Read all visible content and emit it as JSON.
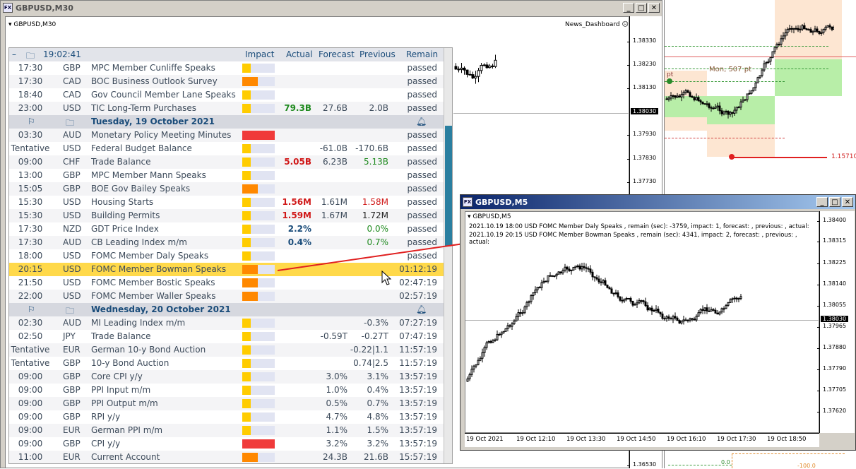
{
  "main_window": {
    "title": "GBPUSD,M30",
    "symbol_label": "GBPUSD,M30",
    "indicator": "News_Dashboard",
    "price_ticks": [
      "1.38330",
      "1.38230",
      "1.38130",
      "1.38030",
      "1.37930",
      "1.37830",
      "1.37730",
      "1.36530"
    ],
    "current_price": "1.38030"
  },
  "right_chart": {
    "level_price": "1.15710",
    "annotation": "Mon, 507 pt",
    "pt_label": "pt",
    "bottom_left": "0.0",
    "bottom_right": "-100.0"
  },
  "m5_window": {
    "title": "GBPUSD,M5",
    "symbol_label": "GBPUSD,M5",
    "log_lines": [
      "2021.10.19 18:00 USD FOMC Member Daly Speaks , remain (sec): -3759, impact: 1, forecast: , previous: , actual:",
      "2021.10.19 20:15 USD FOMC Member Bowman Speaks , remain (sec): 4341, impact: 2, forecast: , previous: , actual:"
    ],
    "price_ticks": [
      "1.38400",
      "1.38315",
      "1.38225",
      "1.38140",
      "1.38055",
      "1.37965",
      "1.37880",
      "1.37790",
      "1.37705",
      "1.37620"
    ],
    "current_price": "1.38030",
    "time_ticks": [
      "19 Oct 2021",
      "19 Oct 12:10",
      "19 Oct 13:30",
      "19 Oct 14:50",
      "19 Oct 16:10",
      "19 Oct 17:30",
      "19 Oct 18:50"
    ]
  },
  "dashboard": {
    "header": {
      "collapse": "–",
      "time": "19:02:41",
      "impact": "Impact",
      "actual": "Actual",
      "forecast": "Forecast",
      "previous": "Previous",
      "remain": "Remain"
    },
    "rows": [
      {
        "type": "event",
        "time": "17:30",
        "cur": "GBP",
        "event": "MPC Member Cunliffe Speaks",
        "impact": 1,
        "actual": "",
        "forecast": "",
        "previous": "",
        "remain": "passed"
      },
      {
        "type": "event",
        "time": "17:30",
        "cur": "CAD",
        "event": "BOC Business Outlook Survey",
        "impact": 2,
        "actual": "",
        "forecast": "",
        "previous": "",
        "remain": "passed"
      },
      {
        "type": "event",
        "time": "18:40",
        "cur": "CAD",
        "event": "Gov Council Member Lane Speaks",
        "impact": 1,
        "actual": "",
        "forecast": "",
        "previous": "",
        "remain": "passed"
      },
      {
        "type": "event",
        "time": "23:00",
        "cur": "USD",
        "event": "TIC Long-Term Purchases",
        "impact": 1,
        "actual": "79.3B",
        "actual_color": "green",
        "forecast": "27.6B",
        "previous": "2.0B",
        "remain": "passed"
      },
      {
        "type": "date",
        "label": "Tuesday, 19 October 2021"
      },
      {
        "type": "event",
        "time": "03:30",
        "cur": "AUD",
        "event": "Monetary Policy Meeting Minutes",
        "impact": 3,
        "actual": "",
        "forecast": "",
        "previous": "",
        "remain": "passed"
      },
      {
        "type": "event",
        "time": "Tentative",
        "cur": "USD",
        "event": "Federal Budget Balance",
        "impact": 1,
        "actual": "",
        "forecast": "-61.0B",
        "previous": "-170.6B",
        "remain": "passed"
      },
      {
        "type": "event",
        "time": "09:00",
        "cur": "CHF",
        "event": "Trade Balance",
        "impact": 1,
        "actual": "5.05B",
        "actual_color": "red",
        "forecast": "6.23B",
        "previous": "5.13B",
        "prev_color": "green",
        "remain": "passed"
      },
      {
        "type": "event",
        "time": "13:00",
        "cur": "GBP",
        "event": "MPC Member Mann Speaks",
        "impact": 1,
        "actual": "",
        "forecast": "",
        "previous": "",
        "remain": "passed"
      },
      {
        "type": "event",
        "time": "15:05",
        "cur": "GBP",
        "event": "BOE Gov Bailey Speaks",
        "impact": 2,
        "actual": "",
        "forecast": "",
        "previous": "",
        "remain": "passed"
      },
      {
        "type": "event",
        "time": "15:30",
        "cur": "USD",
        "event": "Housing Starts",
        "impact": 1,
        "actual": "1.56M",
        "actual_color": "red",
        "forecast": "1.61M",
        "previous": "1.58M",
        "prev_color": "red",
        "remain": "passed"
      },
      {
        "type": "event",
        "time": "15:30",
        "cur": "USD",
        "event": "Building Permits",
        "impact": 1,
        "actual": "1.59M",
        "actual_color": "red",
        "forecast": "1.67M",
        "previous": "1.72M",
        "prev_color": "blk",
        "remain": "passed"
      },
      {
        "type": "event",
        "time": "17:30",
        "cur": "NZD",
        "event": "GDT Price Index",
        "impact": 1,
        "actual": "2.2%",
        "actual_color": "teal",
        "forecast": "",
        "previous": "0.0%",
        "prev_color": "green",
        "remain": "passed"
      },
      {
        "type": "event",
        "time": "17:30",
        "cur": "AUD",
        "event": "CB Leading Index m/m",
        "impact": 1,
        "actual": "0.4%",
        "actual_color": "teal",
        "forecast": "",
        "previous": "0.7%",
        "prev_color": "green",
        "remain": "passed"
      },
      {
        "type": "event",
        "time": "18:00",
        "cur": "USD",
        "event": "FOMC Member Daly Speaks",
        "impact": 1,
        "actual": "",
        "forecast": "",
        "previous": "",
        "remain": "passed"
      },
      {
        "type": "event",
        "time": "20:15",
        "cur": "USD",
        "event": "FOMC Member Bowman Speaks",
        "impact": 2,
        "actual": "",
        "forecast": "",
        "previous": "",
        "remain": "01:12:19",
        "highlight": true
      },
      {
        "type": "event",
        "time": "21:50",
        "cur": "USD",
        "event": "FOMC Member Bostic Speaks",
        "impact": 2,
        "actual": "",
        "forecast": "",
        "previous": "",
        "remain": "02:47:19"
      },
      {
        "type": "event",
        "time": "22:00",
        "cur": "USD",
        "event": "FOMC Member Waller Speaks",
        "impact": 2,
        "actual": "",
        "forecast": "",
        "previous": "",
        "remain": "02:57:19"
      },
      {
        "type": "date",
        "label": "Wednesday, 20 October 2021"
      },
      {
        "type": "event",
        "time": "02:30",
        "cur": "AUD",
        "event": "MI Leading Index m/m",
        "impact": 1,
        "actual": "",
        "forecast": "",
        "previous": "-0.3%",
        "remain": "07:27:19"
      },
      {
        "type": "event",
        "time": "02:50",
        "cur": "JPY",
        "event": "Trade Balance",
        "impact": 1,
        "actual": "",
        "forecast": "-0.59T",
        "previous": "-0.27T",
        "remain": "07:47:19"
      },
      {
        "type": "event",
        "time": "Tentative",
        "cur": "EUR",
        "event": "German 10-y Bond Auction",
        "impact": 1,
        "actual": "",
        "forecast": "",
        "previous": "-0.22|1.1",
        "remain": "11:57:19"
      },
      {
        "type": "event",
        "time": "Tentative",
        "cur": "GBP",
        "event": "10-y Bond Auction",
        "impact": 1,
        "actual": "",
        "forecast": "",
        "previous": "0.74|2.5",
        "remain": "11:57:19"
      },
      {
        "type": "event",
        "time": "09:00",
        "cur": "GBP",
        "event": "Core CPI y/y",
        "impact": 1,
        "actual": "",
        "forecast": "3.0%",
        "previous": "3.1%",
        "remain": "13:57:19"
      },
      {
        "type": "event",
        "time": "09:00",
        "cur": "GBP",
        "event": "PPI Input m/m",
        "impact": 1,
        "actual": "",
        "forecast": "1.0%",
        "previous": "0.4%",
        "remain": "13:57:19"
      },
      {
        "type": "event",
        "time": "09:00",
        "cur": "GBP",
        "event": "PPI Output m/m",
        "impact": 1,
        "actual": "",
        "forecast": "0.5%",
        "previous": "0.7%",
        "remain": "13:57:19"
      },
      {
        "type": "event",
        "time": "09:00",
        "cur": "GBP",
        "event": "RPI y/y",
        "impact": 1,
        "actual": "",
        "forecast": "4.7%",
        "previous": "4.8%",
        "remain": "13:57:19"
      },
      {
        "type": "event",
        "time": "09:00",
        "cur": "EUR",
        "event": "German PPI m/m",
        "impact": 1,
        "actual": "",
        "forecast": "1.1%",
        "previous": "1.5%",
        "remain": "13:57:19"
      },
      {
        "type": "event",
        "time": "09:00",
        "cur": "GBP",
        "event": "CPI y/y",
        "impact": 3,
        "actual": "",
        "forecast": "3.2%",
        "previous": "3.2%",
        "remain": "13:57:19"
      },
      {
        "type": "event",
        "time": "11:00",
        "cur": "EUR",
        "event": "Current Account",
        "impact": 2,
        "actual": "",
        "forecast": "24.3B",
        "previous": "21.6B",
        "remain": "15:57:19"
      }
    ]
  },
  "colors": {
    "impact_low": "#ffcc00",
    "impact_medium": "#ff8800",
    "impact_high": "#f03a3a",
    "bull_zone": "#b8eea8",
    "bear_zone": "#fde6d2"
  }
}
